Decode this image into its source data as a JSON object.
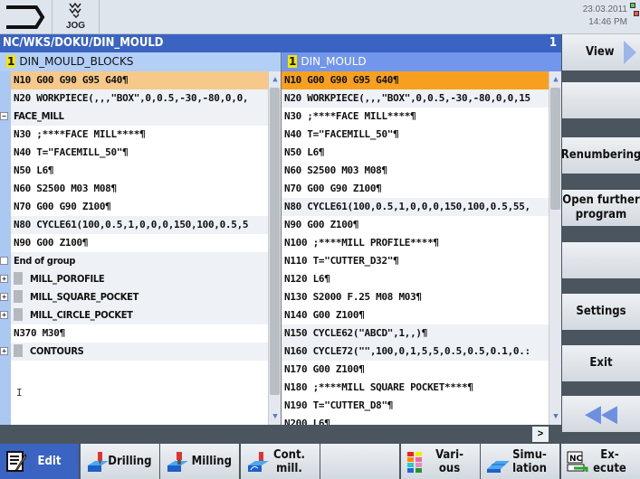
{
  "header": {
    "mode": "JOG",
    "date": "23.03.2011",
    "time": "14:46 PM"
  },
  "path": {
    "title": "NC/WKS/DOKU/DIN_MOULD",
    "channel": "1"
  },
  "left": {
    "num": "1",
    "title": "DIN_MOULD_BLOCKS",
    "rows": [
      {
        "t": "N10 G00 G90 G95 G40¶",
        "s": "sel"
      },
      {
        "t": "N20 WORKPIECE(,,,\"BOX\",0,0.5,-30,-80,0,0,",
        "s": "alt"
      },
      {
        "t": "FACE_MILL",
        "s": "alt",
        "pm": "−"
      },
      {
        "t": "N30 ;****FACE MILL****¶"
      },
      {
        "t": "N40 T=\"FACEMILL_50\"¶"
      },
      {
        "t": "N50 L6¶"
      },
      {
        "t": "N60 S2500 M03 M08¶"
      },
      {
        "t": "N70 G00 G90 Z100¶"
      },
      {
        "t": "N80 CYCLE61(100,0.5,1,0,0,0,150,100,0.5,5",
        "s": "alt"
      },
      {
        "t": "N90 G00 Z100¶"
      },
      {
        "t": "End of group",
        "s": "alt",
        "pm": " "
      },
      {
        "t": "MILL_POROFILE",
        "s": "alt",
        "pm": "+",
        "g": 1
      },
      {
        "t": "MILL_SQUARE_POCKET",
        "s": "alt",
        "pm": "+",
        "g": 1
      },
      {
        "t": "MILL_CIRCLE_POCKET",
        "s": "alt",
        "pm": "+",
        "g": 1
      },
      {
        "t": "N370 M30¶"
      },
      {
        "t": "CONTOURS",
        "s": "alt",
        "pm": "+",
        "g": 1
      }
    ]
  },
  "right": {
    "num": "1",
    "title": "DIN_MOULD",
    "rows": [
      {
        "t": "N10 G00 G90 G95 G40¶",
        "s": "sel"
      },
      {
        "t": "N20 WORKPIECE(,,,\"BOX\",0,0.5,-30,-80,0,0,15",
        "s": "alt"
      },
      {
        "t": "N30 ;****FACE MILL****¶"
      },
      {
        "t": "N40 T=\"FACEMILL_50\"¶"
      },
      {
        "t": "N50 L6¶"
      },
      {
        "t": "N60 S2500 M03 M08¶"
      },
      {
        "t": "N70 G00 G90 Z100¶"
      },
      {
        "t": "N80 CYCLE61(100,0.5,1,0,0,0,150,100,0.5,55,",
        "s": "alt"
      },
      {
        "t": "N90 G00 Z100¶"
      },
      {
        "t": "N100 ;****MILL PROFILE****¶"
      },
      {
        "t": "N110 T=\"CUTTER_D32\"¶"
      },
      {
        "t": "N120 L6¶"
      },
      {
        "t": "N130 S2000 F.25 M08 M03¶"
      },
      {
        "t": "N140 G00 Z100¶"
      },
      {
        "t": "N150 CYCLE62(\"ABCD\",1,,)¶",
        "s": "alt"
      },
      {
        "t": "N160 CYCLE72(\"\",100,0,1,5,5,0.5,0.5,0.1,0.:",
        "s": "alt"
      },
      {
        "t": "N170 G00 Z100¶"
      },
      {
        "t": "N180 ;****MILL SQUARE POCKET****¶"
      },
      {
        "t": "N190 T=\"CUTTER_D8\"¶"
      },
      {
        "t": "N200 L6¶"
      }
    ]
  },
  "vsoftkeys": [
    "View",
    "",
    "Renumbering",
    "Open further program",
    "",
    "Settings",
    "Exit",
    ""
  ],
  "hsoftkeys": [
    {
      "label": "Edit",
      "icon": "edit-icon",
      "active": true
    },
    {
      "label": "Drilling",
      "icon": "drilling-icon"
    },
    {
      "label": "Milling",
      "icon": "milling-icon"
    },
    {
      "label": "Cont. mill.",
      "icon": "contour-milling-icon"
    },
    {
      "label": "",
      "icon": ""
    },
    {
      "label": "Vari- ous",
      "icon": "various-icon"
    },
    {
      "label": "Simu- lation",
      "icon": "simulation-icon"
    },
    {
      "label": "Ex- ecute",
      "icon": "execute-icon"
    }
  ],
  "colors": {
    "accent": "#3a63c2",
    "sel_left": "#f6c98b",
    "sel_right": "#f7a020"
  }
}
